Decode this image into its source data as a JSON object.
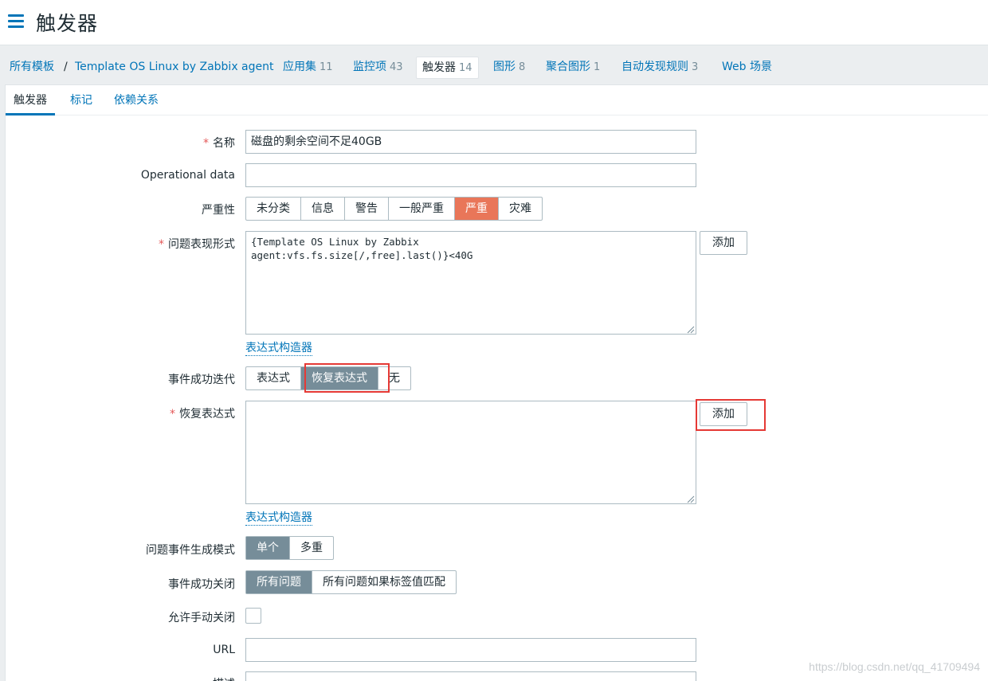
{
  "header": {
    "title": "触发器"
  },
  "nav": {
    "all_templates": "所有模板",
    "separator": "/",
    "template_name": "Template OS Linux by Zabbix agent",
    "tabs": [
      {
        "label": "应用集",
        "count": "11"
      },
      {
        "label": "监控项",
        "count": "43"
      },
      {
        "label": "触发器",
        "count": "14"
      },
      {
        "label": "图形",
        "count": "8"
      },
      {
        "label": "聚合图形",
        "count": "1"
      },
      {
        "label": "自动发现规则",
        "count": "3"
      },
      {
        "label": "Web 场景",
        "count": ""
      }
    ]
  },
  "subtabs": [
    "触发器",
    "标记",
    "依赖关系"
  ],
  "form": {
    "required_mark": "*",
    "name_label": "名称",
    "name_value": "磁盘的剩余空间不足40GB",
    "opdata_label": "Operational data",
    "opdata_value": "",
    "severity_label": "严重性",
    "severity_options": [
      "未分类",
      "信息",
      "警告",
      "一般严重",
      "严重",
      "灾难"
    ],
    "severity_selected": "严重",
    "problem_expr_label": "问题表现形式",
    "problem_expr_value": "{Template OS Linux by Zabbix\nagent:vfs.fs.size[/,free].last()}<40G",
    "add_label": "添加",
    "expr_builder_link": "表达式构造器",
    "ok_event_label": "事件成功迭代",
    "ok_event_options": [
      "表达式",
      "恢复表达式",
      "无"
    ],
    "ok_event_selected": "恢复表达式",
    "recovery_expr_label": "恢复表达式",
    "recovery_expr_value": "",
    "gen_mode_label": "问题事件生成模式",
    "gen_mode_options": [
      "单个",
      "多重"
    ],
    "gen_mode_selected": "单个",
    "ok_close_label": "事件成功关闭",
    "ok_close_options": [
      "所有问题",
      "所有问题如果标签值匹配"
    ],
    "ok_close_selected": "所有问题",
    "manual_close_label": "允许手动关闭",
    "url_label": "URL",
    "url_value": "",
    "desc_label": "描述"
  },
  "watermark": "https://blog.csdn.net/qq_41709494",
  "colors": {
    "link": "#0275b8",
    "severity_high": "#e97659",
    "selected_grey": "#768d99",
    "highlight": "#e53935"
  }
}
